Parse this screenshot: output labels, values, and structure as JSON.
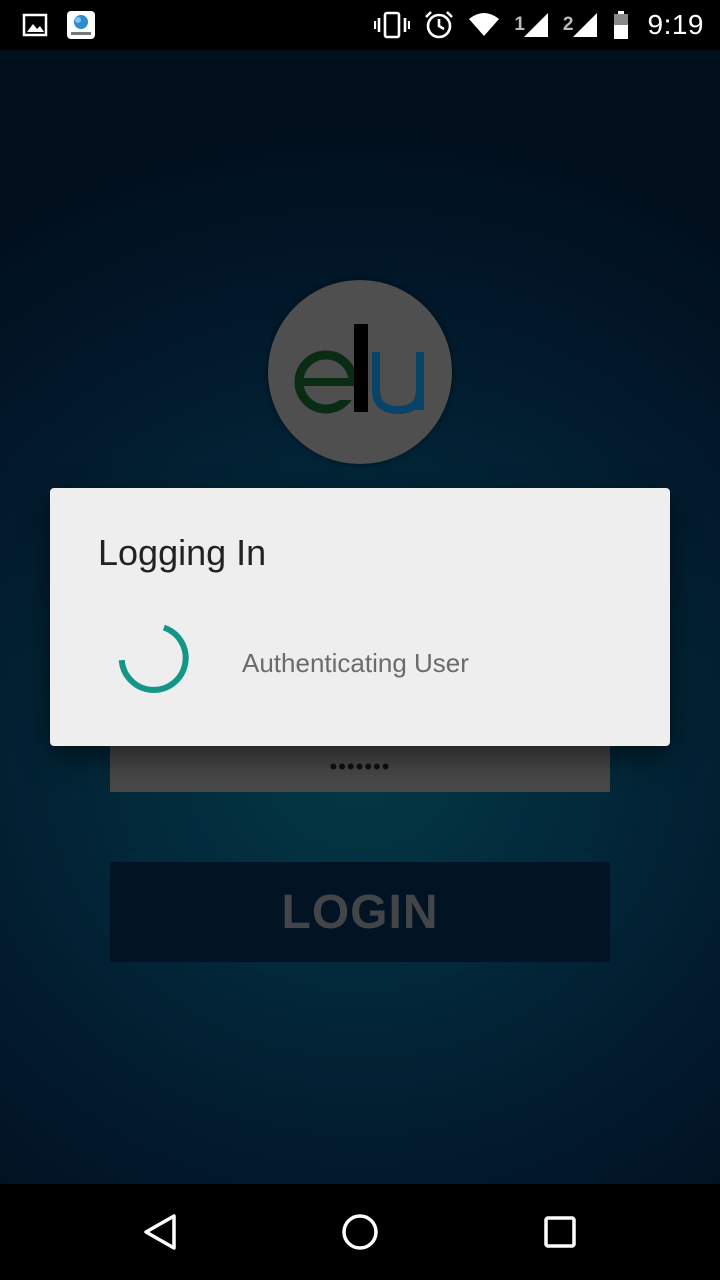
{
  "status_bar": {
    "time": "9:19",
    "sim1_label": "1",
    "sim2_label": "2",
    "icons": [
      "image-notification-icon",
      "eaccess-app-icon",
      "vibrate-icon",
      "alarm-icon",
      "wifi-icon",
      "signal-sim1-icon",
      "signal-sim2-icon",
      "battery-icon"
    ]
  },
  "login_form": {
    "password_value": "•••••••",
    "login_button_label": "LOGIN"
  },
  "logo": {
    "alt_letters": "edu",
    "colors": {
      "circle": "#6e6e6e",
      "e": "#0f3d1c",
      "d": "#000000",
      "u": "#0b5f8f"
    }
  },
  "dialog": {
    "title": "Logging In",
    "message": "Authenticating User",
    "spinner_color": "#139688"
  },
  "nav_bar": {
    "icons": [
      "back-icon",
      "home-icon",
      "recents-icon"
    ]
  }
}
